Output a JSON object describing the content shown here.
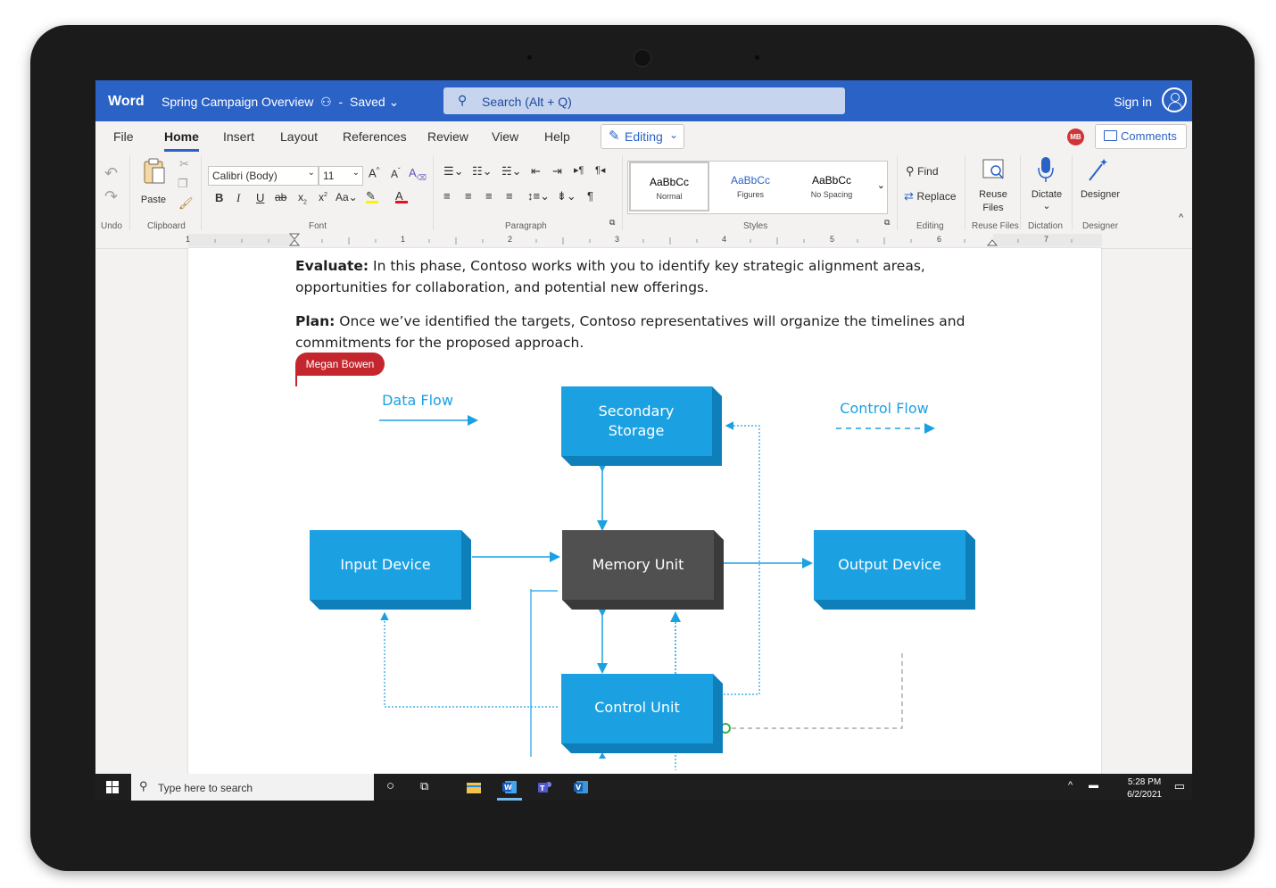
{
  "titlebar": {
    "app_name": "Word",
    "document_title": "Spring Campaign Overview",
    "save_status": "Saved",
    "search_placeholder": "Search (Alt + Q)",
    "sign_in": "Sign in"
  },
  "tabs": [
    "File",
    "Home",
    "Insert",
    "Layout",
    "References",
    "Review",
    "View",
    "Help"
  ],
  "active_tab": "Home",
  "mode_button": "Editing",
  "user_initials": "MB",
  "comments_button": "Comments",
  "ribbon": {
    "groups": {
      "undo": "Undo",
      "clipboard": "Clipboard",
      "font": "Font",
      "paragraph": "Paragraph",
      "styles": "Styles",
      "editing": "Editing",
      "reuse_files": "Reuse Files",
      "dictation": "Dictation",
      "designer": "Designer"
    },
    "paste": "Paste",
    "font_name": "Calibri (Body)",
    "font_size": "11",
    "styles": [
      {
        "sample": "AaBbCc",
        "name": "Normal"
      },
      {
        "sample": "AaBbCc",
        "name": "Figures"
      },
      {
        "sample": "AaBbCc",
        "name": "No Spacing"
      }
    ],
    "find": "Find",
    "replace": "Replace",
    "reuse_files_l1": "Reuse",
    "reuse_files_l2": "Files",
    "dictate": "Dictate",
    "designer": "Designer"
  },
  "ruler_numbers": [
    "1",
    "1",
    "2",
    "3",
    "4",
    "5",
    "6",
    "7"
  ],
  "document": {
    "para1_label": "Evaluate:",
    "para1_text": " In this phase, Contoso works with you to identify key strategic alignment areas, opportunities for collaboration, and potential new offerings.",
    "para2_label": "Plan:",
    "para2_text": " Once we’ve identified the targets, Contoso representatives will organize the timelines and commitments for the proposed approach.",
    "coauthor_tag": "Megan Bowen"
  },
  "diagram": {
    "legend_data_flow": "Data Flow",
    "legend_control_flow": "Control Flow",
    "secondary_storage_l1": "Secondary",
    "secondary_storage_l2": "Storage",
    "input_device": "Input Device",
    "memory_unit": "Memory Unit",
    "output_device": "Output Device",
    "control_unit": "Control Unit",
    "colors": {
      "box": "#1ba1e2",
      "box_dark": "#0f7fba",
      "memory": "#505050",
      "memory_dark": "#3a3a3a",
      "arrow": "#1ba1e2"
    }
  },
  "taskbar": {
    "search_placeholder": "Type here to search",
    "time": "5:28 PM",
    "date": "6/2/2021"
  }
}
